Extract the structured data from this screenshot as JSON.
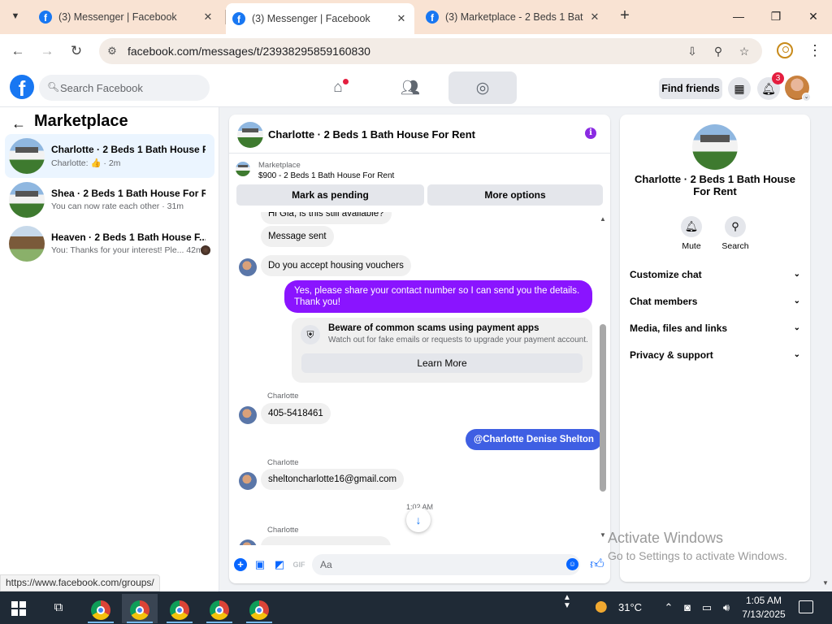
{
  "browser": {
    "tabs": [
      {
        "label": "(3) Messenger | Facebook",
        "close": "✕"
      },
      {
        "label": "(3) Messenger | Facebook",
        "close": "✕"
      },
      {
        "label": "(3) Marketplace - 2 Beds 1 Bath",
        "close": "✕"
      }
    ],
    "new_tab": "+",
    "url": "facebook.com/messages/t/23938295859160830",
    "window_controls": {
      "minimize": "—",
      "maximize": "❐",
      "close": "✕"
    }
  },
  "fb_header": {
    "search_placeholder": "Search Facebook",
    "find_friends": "Find friends",
    "notifications_count": "3"
  },
  "sidebar": {
    "title": "Marketplace",
    "conversations": [
      {
        "name": "Charlotte · 2 Beds 1 Bath House Fo...",
        "preview": "Charlotte: 👍 · 2m"
      },
      {
        "name": "Shea · 2 Beds 1 Bath House For Rent",
        "preview": "You can now rate each other · 31m"
      },
      {
        "name": "Heaven · 2 Beds 1 Bath House F...",
        "preview": "You: Thanks for your interest! Ple...  42m"
      }
    ]
  },
  "status_url": "https://www.facebook.com/groups/",
  "chat": {
    "title": "Charlotte · 2 Beds 1 Bath House For Rent",
    "marketplace_label": "Marketplace",
    "listing": "$900 - 2 Beds 1 Bath House For Rent",
    "mark_pending": "Mark as pending",
    "more_options": "More options",
    "messages": {
      "m0": "Hi Gia, is this still available?",
      "m1": "Message sent",
      "m2": "Do you accept housing vouchers",
      "m3_line1": "Yes, please share your contact number so I can send you the details.",
      "m3_line2": "Thank you!",
      "scam_title": "Beware of common scams using payment apps",
      "scam_sub": "Watch out for fake emails or requests to upgrade your payment account.",
      "learn_more": "Learn More",
      "sender1": "Charlotte",
      "m4": "405-5418461",
      "m5": "@Charlotte Denise Shelton",
      "sender2": "Charlotte",
      "m6": "sheltoncharlotte16@gmail.com",
      "time": "1:02 AM",
      "sender3": "Charlotte"
    },
    "composer_placeholder": "Aa"
  },
  "info_panel": {
    "title": "Charlotte · 2 Beds 1 Bath House For Rent",
    "mute": "Mute",
    "search": "Search",
    "rows": [
      "Customize chat",
      "Chat members",
      "Media, files and links",
      "Privacy & support"
    ]
  },
  "watermark": {
    "line1": "Activate Windows",
    "line2": "Go to Settings to activate Windows."
  },
  "taskbar": {
    "temperature": "31°C",
    "time": "1:05 AM",
    "date": "7/13/2025"
  }
}
